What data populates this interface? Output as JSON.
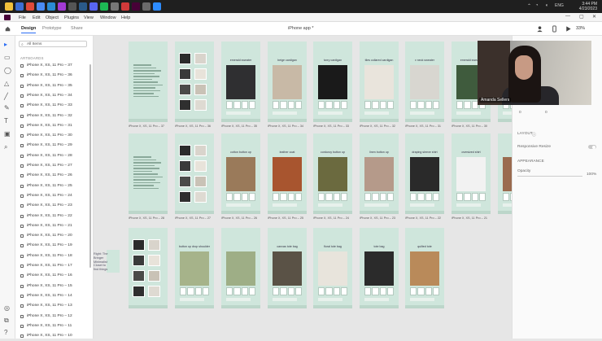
{
  "taskbar": {
    "apps": [
      {
        "name": "file-explorer-icon",
        "color": "#f3c13b"
      },
      {
        "name": "windows-store-icon",
        "color": "#3d6fd4"
      },
      {
        "name": "chrome-icon",
        "color": "#e04a3a"
      },
      {
        "name": "docs-icon",
        "color": "#4a8bf5"
      },
      {
        "name": "vscode-icon",
        "color": "#2a8bd4"
      },
      {
        "name": "photos-icon",
        "color": "#a33ad4"
      },
      {
        "name": "app-icon",
        "color": "#555555"
      },
      {
        "name": "steam-icon",
        "color": "#2a5a8a"
      },
      {
        "name": "discord-icon",
        "color": "#5865f2"
      },
      {
        "name": "spotify-icon",
        "color": "#1db954"
      },
      {
        "name": "mail-icon",
        "color": "#777777"
      },
      {
        "name": "adobe-icon",
        "color": "#d13a3a"
      },
      {
        "name": "xd-icon",
        "color": "#470137"
      },
      {
        "name": "app-icon",
        "color": "#6b6b6b"
      },
      {
        "name": "zoom-icon",
        "color": "#2d8cff"
      }
    ],
    "lang": "ENG",
    "time": "3:44 PM",
    "date": "4/23/2023"
  },
  "menubar": {
    "items": [
      "File",
      "Edit",
      "Object",
      "Plugins",
      "View",
      "Window",
      "Help"
    ]
  },
  "topbar": {
    "tabs": [
      "Design",
      "Prototype",
      "Share"
    ],
    "document": "iPhone app *",
    "zoom": "33%"
  },
  "tools": [
    "select-tool-icon",
    "rectangle-tool-icon",
    "ellipse-tool-icon",
    "polygon-tool-icon",
    "line-tool-icon",
    "pen-tool-icon",
    "text-tool-icon",
    "artboard-tool-icon",
    "zoom-tool-icon",
    "assets-icon",
    "plugins-icon",
    "help-icon"
  ],
  "layers": {
    "search_label": "All Items",
    "section_label": "ARTBOARDS",
    "items": [
      "iPhone X, XS, 11 Pro – 37",
      "iPhone X, XS, 11 Pro – 36",
      "iPhone X, XS, 11 Pro – 35",
      "iPhone X, XS, 11 Pro – 34",
      "iPhone X, XS, 11 Pro – 33",
      "iPhone X, XS, 11 Pro – 32",
      "iPhone X, XS, 11 Pro – 31",
      "iPhone X, XS, 11 Pro – 30",
      "iPhone X, XS, 11 Pro – 29",
      "iPhone X, XS, 11 Pro – 28",
      "iPhone X, XS, 11 Pro – 27",
      "iPhone X, XS, 11 Pro – 26",
      "iPhone X, XS, 11 Pro – 25",
      "iPhone X, XS, 11 Pro – 24",
      "iPhone X, XS, 11 Pro – 23",
      "iPhone X, XS, 11 Pro – 22",
      "iPhone X, XS, 11 Pro – 21",
      "iPhone X, XS, 11 Pro – 20",
      "iPhone X, XS, 11 Pro – 19",
      "iPhone X, XS, 11 Pro – 18",
      "iPhone X, XS, 11 Pro – 17",
      "iPhone X, XS, 11 Pro – 16",
      "iPhone X, XS, 11 Pro – 15",
      "iPhone X, XS, 11 Pro – 14",
      "iPhone X, XS, 11 Pro – 13",
      "iPhone X, XS, 11 Pro – 12",
      "iPhone X, XS, 11 Pro – 11",
      "iPhone X, XS, 11 Pro – 10"
    ]
  },
  "canvas": {
    "rows": [
      {
        "artboards": [
          {
            "kind": "text",
            "label": "iPhone X, XS, 11 Pro – 37",
            "title": "",
            "photo": "#cfe6dc"
          },
          {
            "kind": "grid",
            "label": "iPhone X, XS, 11 Pro – 36",
            "title": "",
            "photo": "#cfe6dc"
          },
          {
            "kind": "product",
            "label": "iPhone X, XS, 11 Pro – 35",
            "title": "emerald sweater",
            "photo": "#2f2f31"
          },
          {
            "kind": "product",
            "label": "iPhone X, XS, 11 Pro – 34",
            "title": "beige cardigan",
            "photo": "#c8b9a6"
          },
          {
            "kind": "product",
            "label": "iPhone X, XS, 11 Pro – 33",
            "title": "ivory cardigan",
            "photo": "#1a1a1a"
          },
          {
            "kind": "product",
            "label": "iPhone X, XS, 11 Pro – 32",
            "title": "tiles collared cardigan",
            "photo": "#e9e4dc"
          },
          {
            "kind": "product",
            "label": "iPhone X, XS, 11 Pro – 31",
            "title": "v neck sweater",
            "photo": "#d8d6d0"
          },
          {
            "kind": "product",
            "label": "iPhone X, XS, 11 Pro – 30",
            "title": "emerald sweater",
            "photo": "#3f5b3d"
          },
          {
            "kind": "product",
            "label": "",
            "title": "",
            "photo": "#8c7a6a"
          }
        ]
      },
      {
        "artboards": [
          {
            "kind": "text",
            "label": "iPhone X, XS, 11 Pro – 28",
            "title": "",
            "photo": "#cfe6dc"
          },
          {
            "kind": "grid",
            "label": "iPhone X, XS, 11 Pro – 27",
            "title": "",
            "photo": "#cfe6dc"
          },
          {
            "kind": "product",
            "label": "iPhone X, XS, 11 Pro – 26",
            "title": "cotton button up",
            "photo": "#9a7a5a"
          },
          {
            "kind": "product",
            "label": "iPhone X, XS, 11 Pro – 25",
            "title": "leather coat",
            "photo": "#a8552f"
          },
          {
            "kind": "product",
            "label": "iPhone X, XS, 11 Pro – 24",
            "title": "corduroy button up",
            "photo": "#6b6a3f"
          },
          {
            "kind": "product",
            "label": "iPhone X, XS, 11 Pro – 23",
            "title": "linen button up",
            "photo": "#b59a8a"
          },
          {
            "kind": "product",
            "label": "iPhone X, XS, 11 Pro – 22",
            "title": "draping sleeve shirt",
            "photo": "#2a2a2a"
          },
          {
            "kind": "product",
            "label": "iPhone X, XS, 11 Pro – 21",
            "title": "oversized shirt",
            "photo": "#f2f2f2"
          },
          {
            "kind": "product",
            "label": "",
            "title": "",
            "photo": "#9a6b4f"
          }
        ]
      },
      {
        "artboards": [
          {
            "kind": "grid",
            "label": "",
            "title": "",
            "photo": "#cfe6dc"
          },
          {
            "kind": "product",
            "label": "",
            "title": "button up drop shoulder",
            "photo": "#a6b38a"
          },
          {
            "kind": "product",
            "label": "",
            "title": "",
            "photo": "#9eae86"
          },
          {
            "kind": "product",
            "label": "",
            "title": "canvas tote bag",
            "photo": "#5a5246"
          },
          {
            "kind": "product",
            "label": "",
            "title": "floral tote bag",
            "photo": "#e8e4dc"
          },
          {
            "kind": "product",
            "label": "",
            "title": "tote bag",
            "photo": "#2b2b2b"
          },
          {
            "kind": "product",
            "label": "",
            "title": "quilted tote",
            "photo": "#b98a5a"
          }
        ]
      }
    ],
    "note": "Right: The Bringer Minimalist Closet to find things"
  },
  "right_panel": {
    "layout_label": "LAYOUT",
    "responsive_label": "Responsive Resize",
    "appearance_label": "APPEARANCE",
    "opacity_label": "Opacity",
    "opacity_value": "100%",
    "coord_x": "0",
    "coord_y": "0"
  },
  "webcam": {
    "participant": "Amanda Sellers"
  }
}
